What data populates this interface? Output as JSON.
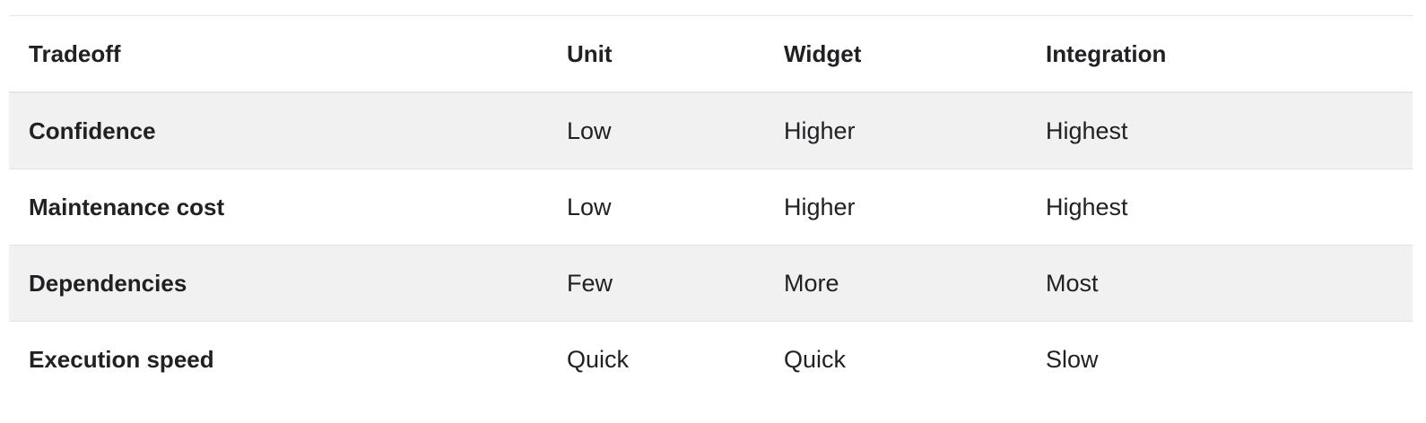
{
  "table": {
    "headers": [
      "Tradeoff",
      "Unit",
      "Widget",
      "Integration"
    ],
    "rows": [
      [
        "Confidence",
        "Low",
        "Higher",
        "Highest"
      ],
      [
        "Maintenance cost",
        "Low",
        "Higher",
        "Highest"
      ],
      [
        "Dependencies",
        "Few",
        "More",
        "Most"
      ],
      [
        "Execution speed",
        "Quick",
        "Quick",
        "Slow"
      ]
    ]
  },
  "colors": {
    "row_shade": "#f1f1f1",
    "border": "#e3e3e3",
    "text": "#202124"
  }
}
